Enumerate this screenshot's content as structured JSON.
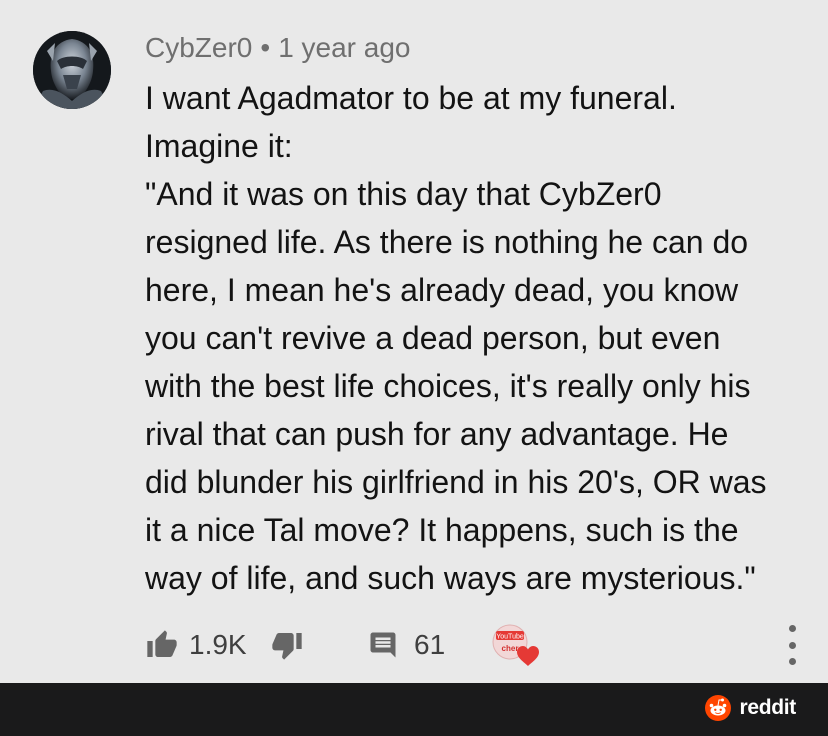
{
  "comment": {
    "author": "CybZer0",
    "separator": "•",
    "timestamp": "1 year ago",
    "body": "I want Agadmator to be at my funeral.\nImagine it:\n\"And it was on this day that CybZer0\nresigned life. As there is nothing he can do\nhere, I mean he's already dead, you know\nyou can't revive a dead person, but even\nwith the best life choices, it's really only his\nrival that can push for any advantage. He\ndid blunder his girlfriend in his 20's, OR was\nit a nice Tal move? It happens, such is the\nway of life, and such ways are mysterious.\""
  },
  "actions": {
    "like_count": "1.9K",
    "reply_count": "61",
    "badge_text_top": "YouTube",
    "badge_text_bottom": "cher"
  },
  "footer": {
    "brand": "reddit"
  },
  "colors": {
    "background": "#e9e9e9",
    "footer": "#1a1a1b",
    "reddit_orange": "#ff4500",
    "heart_red": "#e53935",
    "icon_gray": "#666666"
  },
  "icons": {
    "like": "thumbs-up-icon",
    "dislike": "thumbs-down-icon",
    "reply": "comment-icon",
    "creator_heart": "creator-heart-icon",
    "more": "more-vert-icon",
    "reddit": "reddit-logo-icon"
  }
}
